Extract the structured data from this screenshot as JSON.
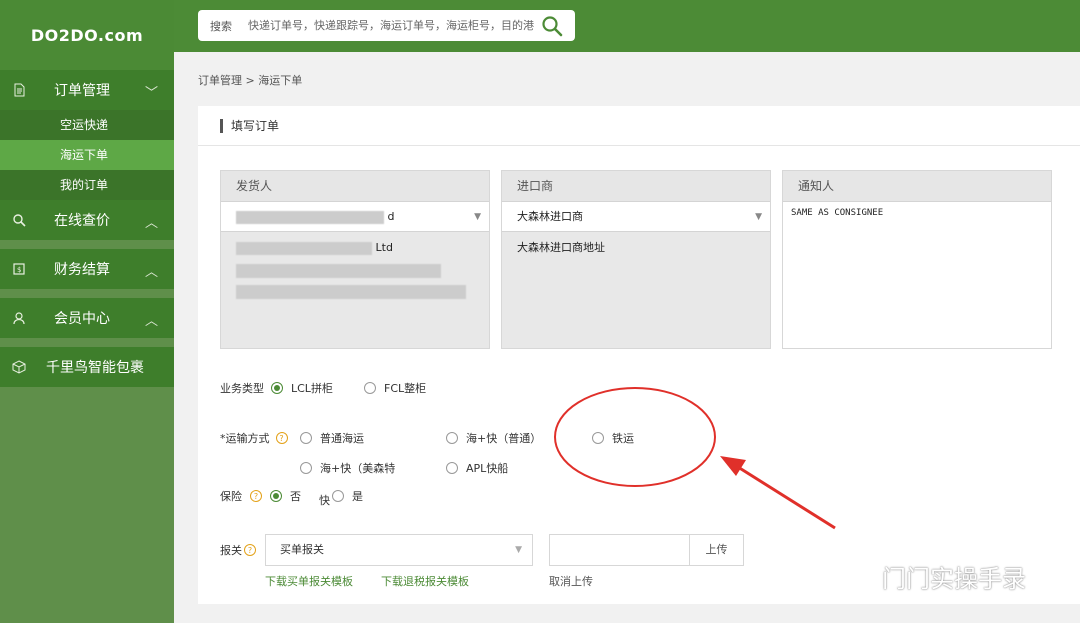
{
  "sidebar": {
    "logo": "DO2DO.com",
    "groups": [
      {
        "icon": "document-icon",
        "label": "订单管理",
        "chevron": "﹀",
        "items": [
          "空运快递",
          "海运下单",
          "我的订单"
        ],
        "active": 1
      },
      {
        "icon": "search-icon",
        "label": "在线查价",
        "chevron": "︿"
      },
      {
        "icon": "finance-icon",
        "label": "财务结算",
        "chevron": "︿"
      },
      {
        "icon": "user-icon",
        "label": "会员中心",
        "chevron": "︿"
      },
      {
        "icon": "package-icon",
        "label": "千里鸟智能包裹"
      }
    ]
  },
  "search": {
    "label": "搜索",
    "placeholder": "快递订单号，快递跟踪号，海运订单号，海运柜号，目的港"
  },
  "breadcrumb": "订单管理 > 海运下单",
  "panel": {
    "title": "填写订单",
    "shipper": {
      "header": "发货人",
      "select": "d",
      "addr_line1": "Ltd"
    },
    "importer": {
      "header": "进口商",
      "select": "大森林进口商",
      "addr": "大森林进口商地址"
    },
    "notify": {
      "header": "通知人",
      "text": "SAME AS CONSIGNEE"
    },
    "business": {
      "label": "业务类型",
      "options": [
        "LCL拼柜",
        "FCL整柜"
      ],
      "selected": 0
    },
    "transport": {
      "label": "*运输方式",
      "options": [
        "普通海运",
        "海+快（普通）",
        "铁运",
        "海+快（美森特",
        "APL快船"
      ]
    },
    "insurance": {
      "label": "保险",
      "no": "否",
      "fast": "快",
      "yes": "是"
    },
    "customs": {
      "label": "报关",
      "select": "买单报关",
      "upload": "上传",
      "link1": "下载买单报关模板",
      "link2": "下载退税报关模板",
      "cancel": "取消上传"
    }
  },
  "watermark": "门门实操手录",
  "colors": {
    "primary": "#4c8b36",
    "sidebar": "#5f8f4a",
    "active": "#5ea846",
    "annotation": "#e0302a"
  }
}
